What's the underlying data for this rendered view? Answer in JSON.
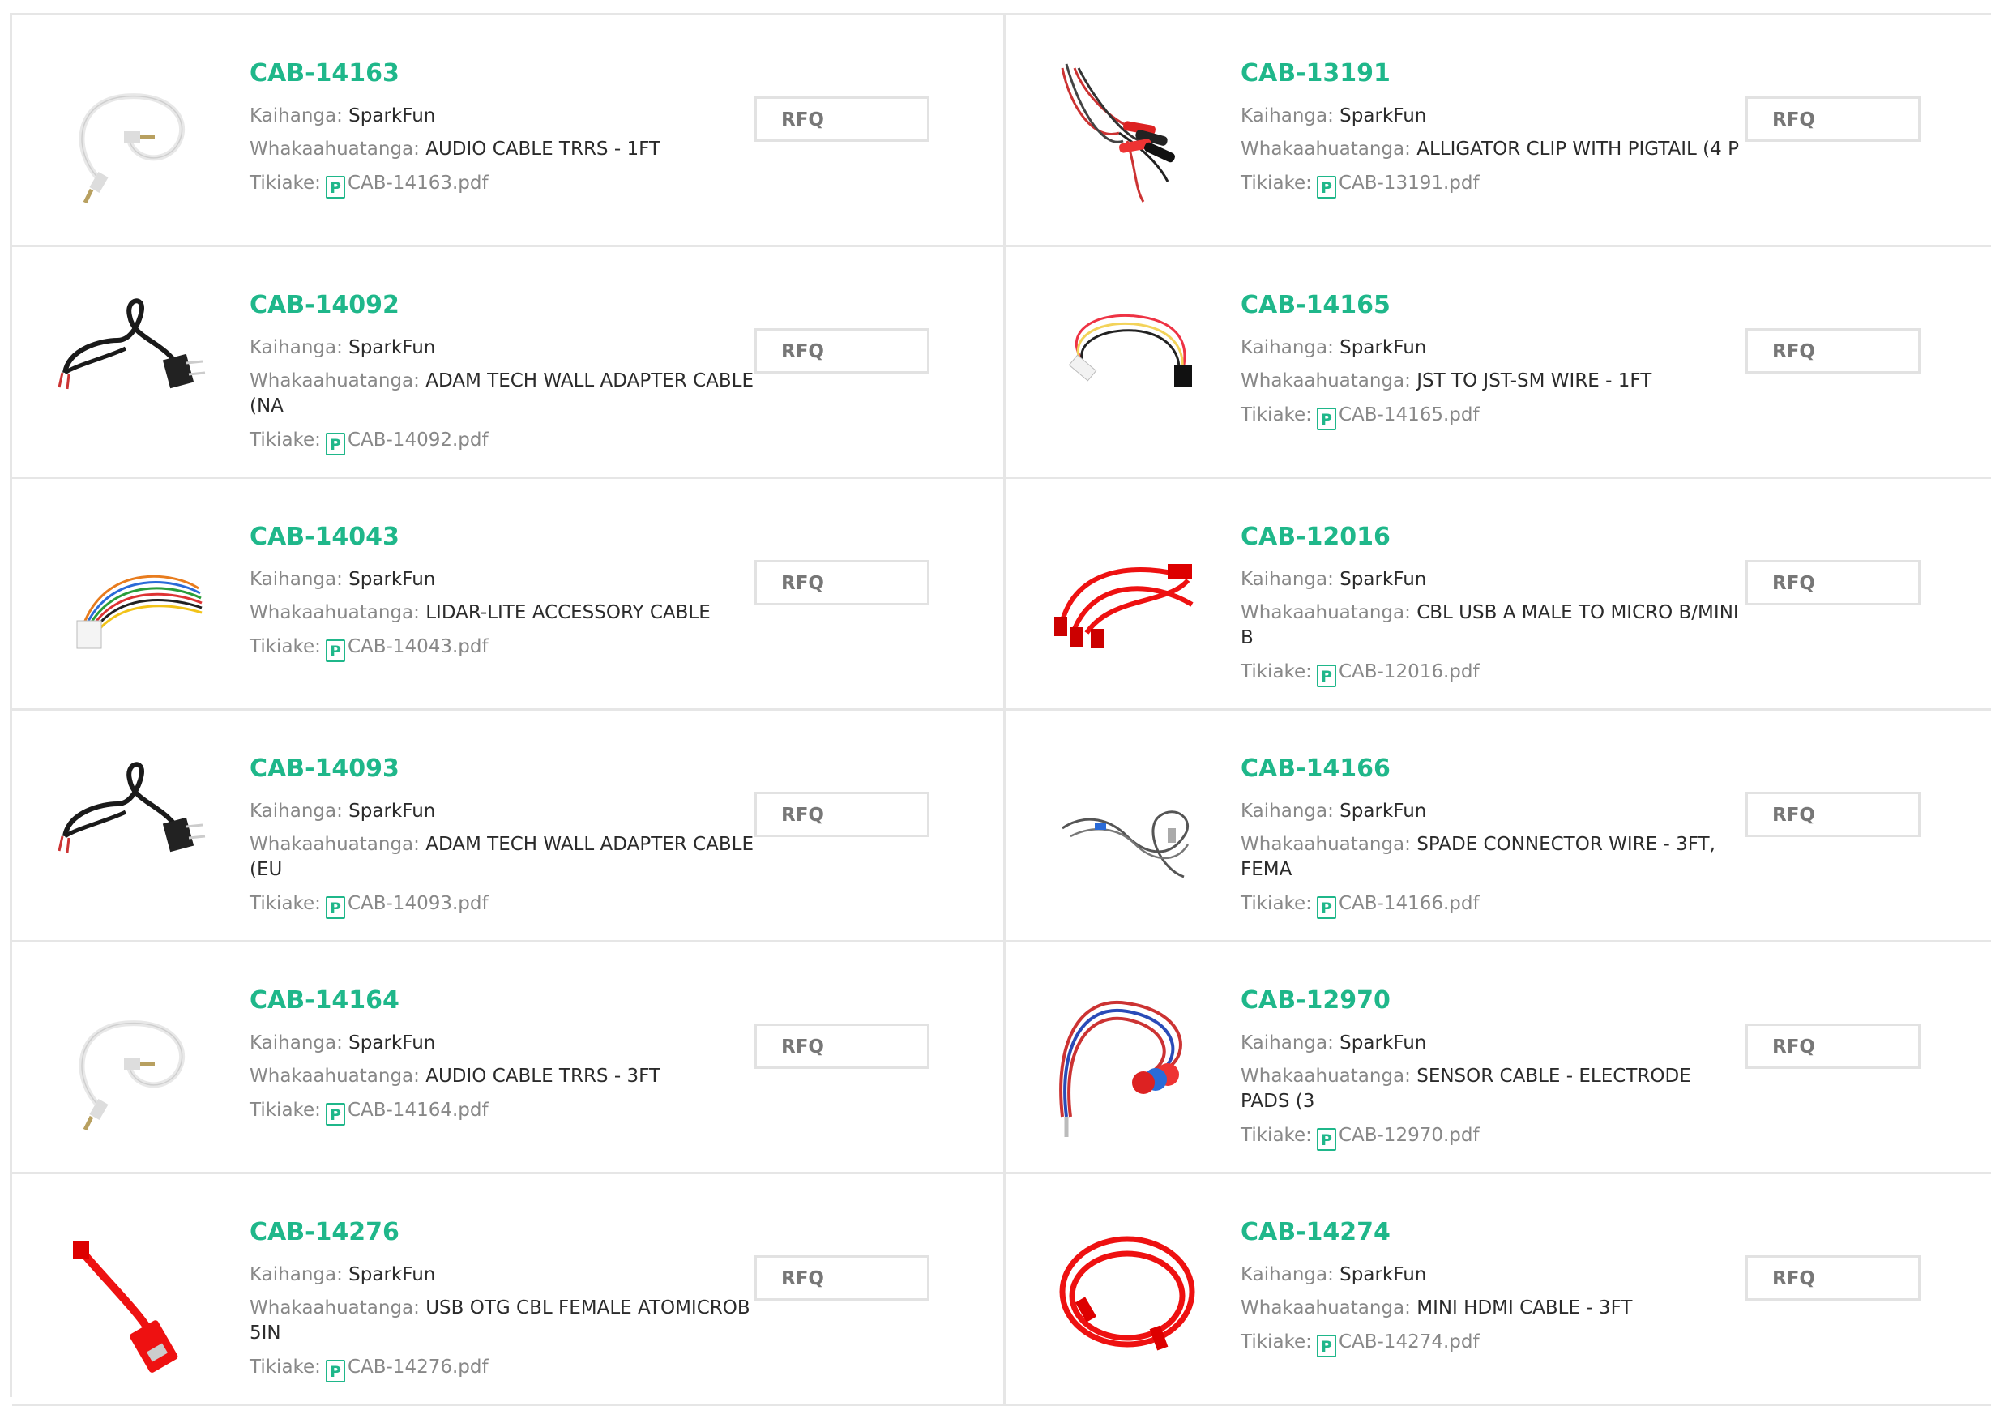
{
  "labels": {
    "manufacturer": "Kaihanga:",
    "description": "Whakaahuatanga:",
    "datasheet": "Tikiake:",
    "rfq": "RFQ",
    "pdf_icon": "P"
  },
  "products": [
    {
      "pn": "CAB-14163",
      "mfr": "SparkFun",
      "desc": "AUDIO CABLE TRRS - 1FT",
      "pdf": "CAB-14163.pdf",
      "icon": "white-audio-cable-icon"
    },
    {
      "pn": "CAB-13191",
      "mfr": "SparkFun",
      "desc": "ALLIGATOR CLIP WITH PIGTAIL (4 P",
      "pdf": "CAB-13191.pdf",
      "icon": "alligator-clip-cables-icon"
    },
    {
      "pn": "CAB-14092",
      "mfr": "SparkFun",
      "desc": "ADAM TECH WALL ADAPTER CABLE (NA",
      "pdf": "CAB-14092.pdf",
      "icon": "wall-adapter-cable-icon"
    },
    {
      "pn": "CAB-14165",
      "mfr": "SparkFun",
      "desc": "JST TO JST-SM WIRE - 1FT",
      "pdf": "CAB-14165.pdf",
      "icon": "jst-wire-icon"
    },
    {
      "pn": "CAB-14043",
      "mfr": "SparkFun",
      "desc": "LIDAR-LITE ACCESSORY CABLE",
      "pdf": "CAB-14043.pdf",
      "icon": "lidar-accessory-cable-icon"
    },
    {
      "pn": "CAB-12016",
      "mfr": "SparkFun",
      "desc": "CBL USB A MALE TO MICRO B/MINI B",
      "pdf": "CAB-12016.pdf",
      "icon": "red-usb-cable-icon"
    },
    {
      "pn": "CAB-14093",
      "mfr": "SparkFun",
      "desc": "ADAM TECH WALL ADAPTER CABLE (EU",
      "pdf": "CAB-14093.pdf",
      "icon": "wall-adapter-cable-icon"
    },
    {
      "pn": "CAB-14166",
      "mfr": "SparkFun",
      "desc": "SPADE CONNECTOR WIRE - 3FT, FEMA",
      "pdf": "CAB-14166.pdf",
      "icon": "spade-connector-wire-icon"
    },
    {
      "pn": "CAB-14164",
      "mfr": "SparkFun",
      "desc": "AUDIO CABLE TRRS - 3FT",
      "pdf": "CAB-14164.pdf",
      "icon": "white-audio-cable-icon"
    },
    {
      "pn": "CAB-12970",
      "mfr": "SparkFun",
      "desc": "SENSOR CABLE - ELECTRODE PADS (3",
      "pdf": "CAB-12970.pdf",
      "icon": "sensor-cable-icon"
    },
    {
      "pn": "CAB-14276",
      "mfr": "SparkFun",
      "desc": "USB OTG CBL FEMALE ATOMICROB 5IN",
      "pdf": "CAB-14276.pdf",
      "icon": "usb-otg-cable-icon"
    },
    {
      "pn": "CAB-14274",
      "mfr": "SparkFun",
      "desc": "MINI HDMI CABLE - 3FT",
      "pdf": "CAB-14274.pdf",
      "icon": "mini-hdmi-cable-icon"
    }
  ]
}
